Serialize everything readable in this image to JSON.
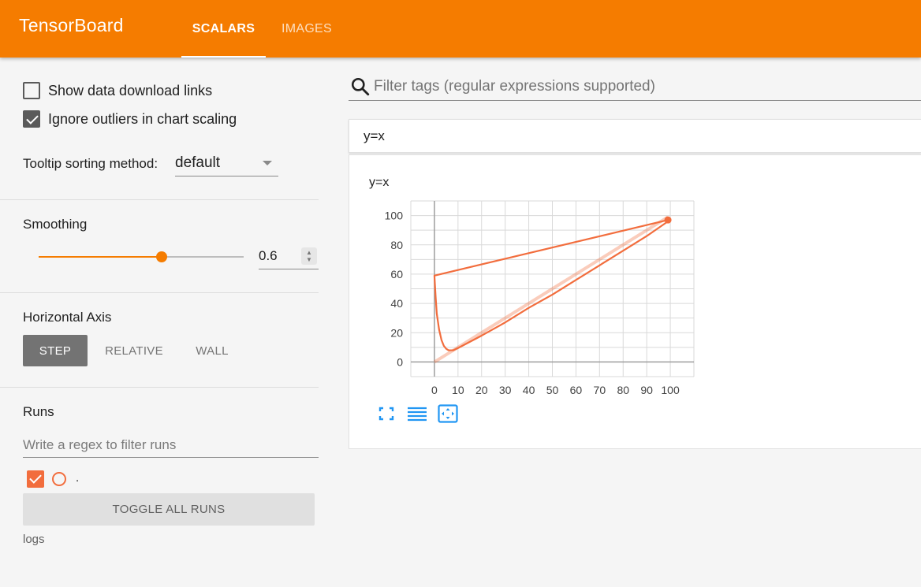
{
  "header": {
    "brand": "TensorBoard",
    "tabs": [
      {
        "label": "SCALARS",
        "active": true
      },
      {
        "label": "IMAGES",
        "active": false
      }
    ],
    "color": "#f57c00"
  },
  "sidebar": {
    "show_download_links": {
      "label": "Show data download links",
      "checked": false
    },
    "ignore_outliers": {
      "label": "Ignore outliers in chart scaling",
      "checked": true
    },
    "tooltip_sorting": {
      "label": "Tooltip sorting method:",
      "value": "default"
    },
    "smoothing": {
      "title": "Smoothing",
      "value": "0.6",
      "fraction": 0.6
    },
    "horizontal_axis": {
      "title": "Horizontal Axis",
      "options": [
        "STEP",
        "RELATIVE",
        "WALL"
      ],
      "selected": "STEP"
    },
    "runs": {
      "title": "Runs",
      "filter_placeholder": "Write a regex to filter runs",
      "items": [
        {
          "name": ".",
          "checked": true,
          "color": "#f26d3d"
        }
      ],
      "toggle_all_label": "TOGGLE ALL RUNS",
      "logdir": "logs"
    }
  },
  "main": {
    "tag_filter_placeholder": "Filter tags (regular expressions supported)",
    "card": {
      "header": "y=x",
      "chart_title": "y=x"
    },
    "icons": [
      "fullscreen-icon",
      "data-table-icon",
      "fit-domain-icon"
    ]
  },
  "chart_data": {
    "type": "line",
    "title": "y=x",
    "xlabel": "",
    "ylabel": "",
    "xlim": [
      -10,
      110
    ],
    "ylim": [
      -10,
      110
    ],
    "x_ticks": [
      0,
      10,
      20,
      30,
      40,
      50,
      60,
      70,
      80,
      90,
      100
    ],
    "y_ticks": [
      0,
      20,
      40,
      60,
      80,
      100
    ],
    "grid": true,
    "series": [
      {
        "color": "#f26d3d",
        "raw": {
          "x": [
            0,
            10,
            20,
            30,
            40,
            50,
            60,
            70,
            80,
            90,
            99
          ],
          "y": [
            0,
            10,
            20,
            30,
            40,
            50,
            60,
            70,
            80,
            90,
            99
          ]
        },
        "smoothed": {
          "x": [
            99,
            0,
            0.5,
            1,
            2,
            3,
            4,
            5,
            6,
            8,
            10,
            20,
            30,
            40,
            50,
            60,
            70,
            80,
            90,
            99
          ],
          "y": [
            97,
            59,
            45,
            33,
            22,
            15,
            11,
            9,
            8,
            8,
            9.5,
            18,
            27,
            37,
            46,
            56,
            66,
            76,
            86,
            96
          ]
        },
        "last_point": {
          "x": 99,
          "y": 97
        }
      }
    ]
  }
}
